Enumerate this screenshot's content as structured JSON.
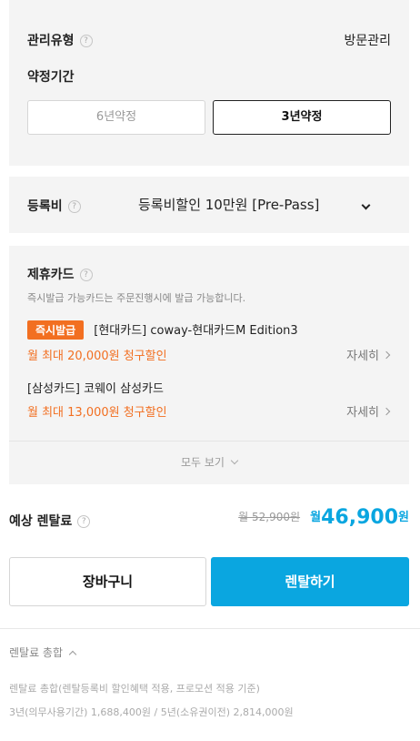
{
  "management": {
    "type_label": "관리유형",
    "type_value": "방문관리",
    "term_label": "약정기간",
    "term_options": [
      "6년약정",
      "3년약정"
    ],
    "selected_term": "3년약정"
  },
  "registration": {
    "label": "등록비",
    "value": "등록비할인 10만원 [Pre-Pass]"
  },
  "partner_cards": {
    "title": "제휴카드",
    "notice": "즉시발급 가능카드는 주문진행시에 발급 가능합니다.",
    "cards": [
      {
        "badge": "즉시발급",
        "name": "[현대카드] coway-현대카드M Edition3",
        "discount": "월 최대 20,000원 청구할인",
        "detail": "자세히"
      },
      {
        "badge": "",
        "name": "[삼성카드] 코웨이 삼성카드",
        "discount": "월 최대 13,000원 청구할인",
        "detail": "자세히"
      }
    ],
    "see_all": "모두 보기"
  },
  "price": {
    "label": "예상 렌탈료",
    "original": "월 52,900원",
    "prefix": "월",
    "amount": "46,900",
    "unit": "원"
  },
  "buttons": {
    "cart": "장바구니",
    "rent": "렌탈하기"
  },
  "summary": {
    "title": "렌탈료 총합",
    "line1": "렌탈료 총합(렌탈등록비 할인혜택 적용, 프로모션 적용 기준)",
    "line2": "3년(의무사용기간) 1,688,400원 / 5년(소유권이전) 2,814,000원"
  },
  "colors": {
    "accent": "#0aa6e0",
    "orange": "#f26f21"
  }
}
